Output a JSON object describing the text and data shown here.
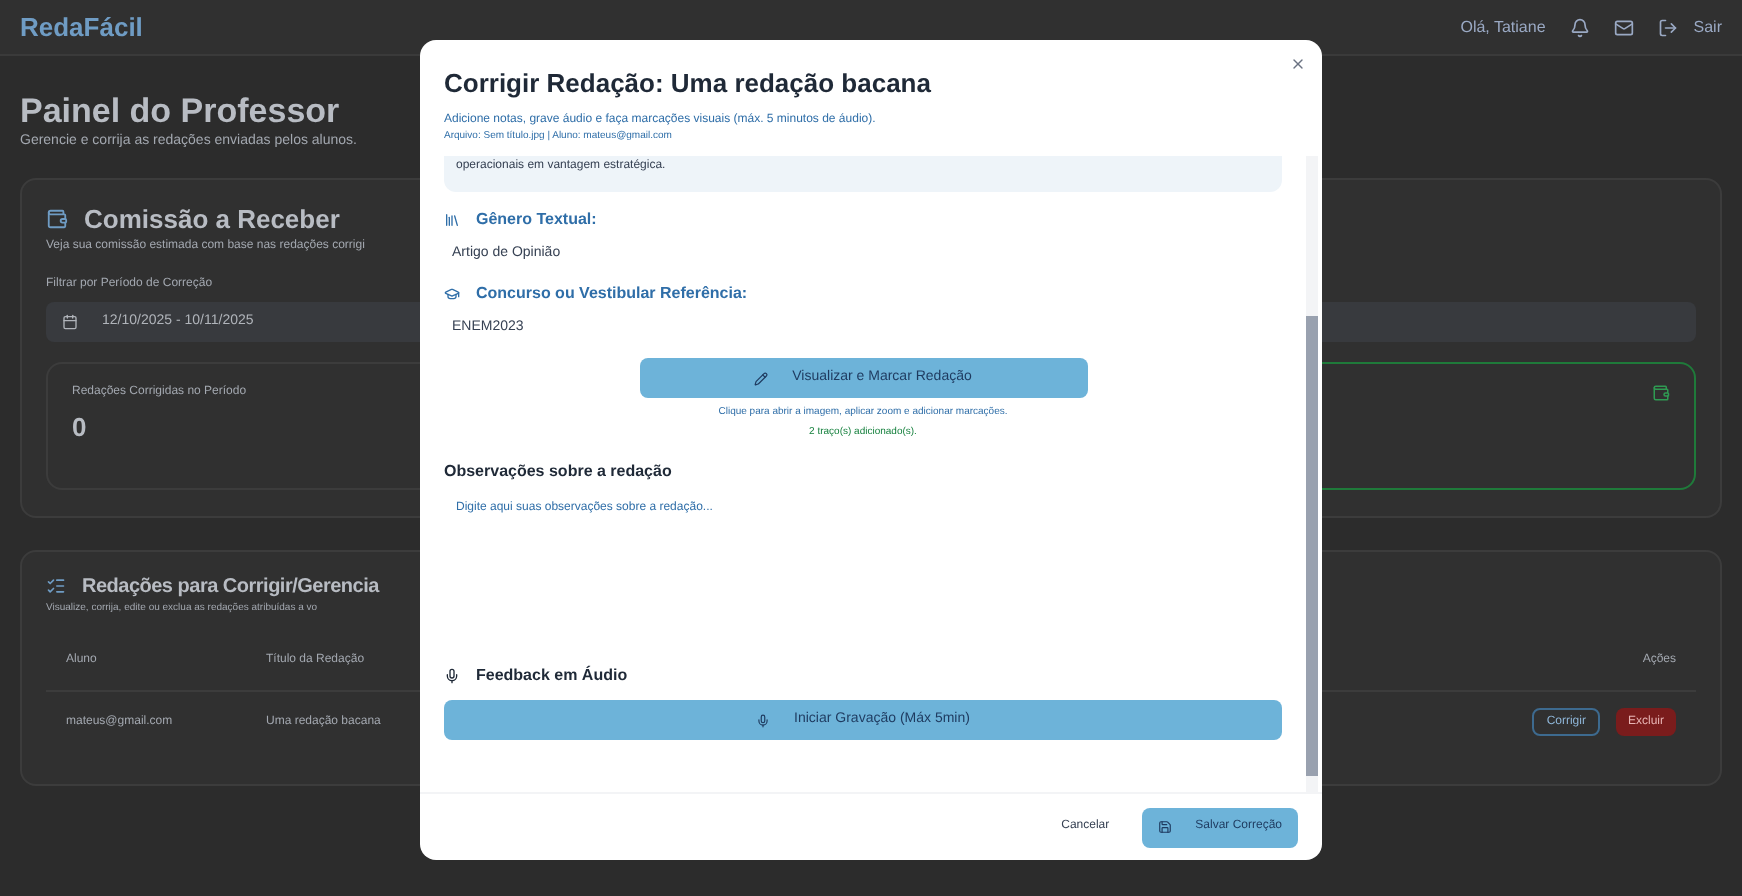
{
  "app": {
    "brand": "RedaFácil",
    "user": "Olá, Tatiane",
    "logout": "Sair"
  },
  "page": {
    "title": "Painel do Professor",
    "subtitle": "Gerencie e corrija as redações enviadas pelos alunos."
  },
  "commission": {
    "title": "Comissão a Receber",
    "description": "Veja sua comissão estimada com base nas redações corrigi",
    "filter_label": "Filtrar por Período de Correção",
    "date_range": "12/10/2025 - 10/11/2025",
    "stats": [
      {
        "label": "Redações Corrigidas no Período",
        "value": "0",
        "highlighted": false
      },
      {
        "highlighted": true
      }
    ]
  },
  "essays": {
    "title": "Redações para Corrigir/Gerencia",
    "description": "Visualize, corrija, edite ou exclua as redações atribuídas a vo",
    "columns": [
      "Aluno",
      "Título da Redação",
      "Ações"
    ],
    "rows": [
      {
        "student": "mateus@gmail.com",
        "title": "Uma redação bacana",
        "actions": [
          {
            "kind": "edit",
            "label": "Corrigir"
          },
          {
            "kind": "delete",
            "label": "Excluir"
          }
        ]
      }
    ]
  },
  "dialog": {
    "title": "Corrigir Redação: Uma redação bacana",
    "subtitle": "Adicione notas, grave áudio e faça marcações visuais (máx. 5 minutos de áudio).",
    "file_info": "Arquivo: Sem título.jpg | Aluno: mateus@gmail.com",
    "excerpt": "operacionais em vantagem estratégica.",
    "fields": [
      {
        "kind": "genre",
        "label": "Gênero Textual:",
        "value": "Artigo de Opinião"
      },
      {
        "kind": "exam",
        "label": "Concurso ou Vestibular Referência:",
        "value": "ENEM2023"
      }
    ],
    "mark_button": "Visualizar e Marcar Redação",
    "mark_hint": "Clique para abrir a imagem, aplicar zoom e adicionar marcações.",
    "strokes_note": "2 traço(s) adicionado(s).",
    "notes_label": "Observações sobre a redação",
    "notes_placeholder": "Digite aqui suas observações sobre a redação...",
    "audio_label": "Feedback em Áudio",
    "record_button": "Iniciar Gravação (Máx 5min)",
    "cancel": "Cancelar",
    "save": "Salvar Correção"
  }
}
